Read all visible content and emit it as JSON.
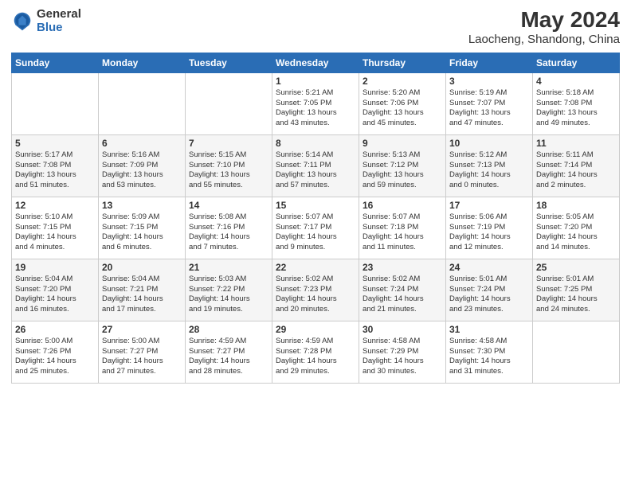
{
  "header": {
    "logo": {
      "general": "General",
      "blue": "Blue"
    },
    "title": "May 2024",
    "location": "Laocheng, Shandong, China"
  },
  "calendar": {
    "days_of_week": [
      "Sunday",
      "Monday",
      "Tuesday",
      "Wednesday",
      "Thursday",
      "Friday",
      "Saturday"
    ],
    "weeks": [
      [
        {
          "day": "",
          "info": ""
        },
        {
          "day": "",
          "info": ""
        },
        {
          "day": "",
          "info": ""
        },
        {
          "day": "1",
          "info": "Sunrise: 5:21 AM\nSunset: 7:05 PM\nDaylight: 13 hours\nand 43 minutes."
        },
        {
          "day": "2",
          "info": "Sunrise: 5:20 AM\nSunset: 7:06 PM\nDaylight: 13 hours\nand 45 minutes."
        },
        {
          "day": "3",
          "info": "Sunrise: 5:19 AM\nSunset: 7:07 PM\nDaylight: 13 hours\nand 47 minutes."
        },
        {
          "day": "4",
          "info": "Sunrise: 5:18 AM\nSunset: 7:08 PM\nDaylight: 13 hours\nand 49 minutes."
        }
      ],
      [
        {
          "day": "5",
          "info": "Sunrise: 5:17 AM\nSunset: 7:08 PM\nDaylight: 13 hours\nand 51 minutes."
        },
        {
          "day": "6",
          "info": "Sunrise: 5:16 AM\nSunset: 7:09 PM\nDaylight: 13 hours\nand 53 minutes."
        },
        {
          "day": "7",
          "info": "Sunrise: 5:15 AM\nSunset: 7:10 PM\nDaylight: 13 hours\nand 55 minutes."
        },
        {
          "day": "8",
          "info": "Sunrise: 5:14 AM\nSunset: 7:11 PM\nDaylight: 13 hours\nand 57 minutes."
        },
        {
          "day": "9",
          "info": "Sunrise: 5:13 AM\nSunset: 7:12 PM\nDaylight: 13 hours\nand 59 minutes."
        },
        {
          "day": "10",
          "info": "Sunrise: 5:12 AM\nSunset: 7:13 PM\nDaylight: 14 hours\nand 0 minutes."
        },
        {
          "day": "11",
          "info": "Sunrise: 5:11 AM\nSunset: 7:14 PM\nDaylight: 14 hours\nand 2 minutes."
        }
      ],
      [
        {
          "day": "12",
          "info": "Sunrise: 5:10 AM\nSunset: 7:15 PM\nDaylight: 14 hours\nand 4 minutes."
        },
        {
          "day": "13",
          "info": "Sunrise: 5:09 AM\nSunset: 7:15 PM\nDaylight: 14 hours\nand 6 minutes."
        },
        {
          "day": "14",
          "info": "Sunrise: 5:08 AM\nSunset: 7:16 PM\nDaylight: 14 hours\nand 7 minutes."
        },
        {
          "day": "15",
          "info": "Sunrise: 5:07 AM\nSunset: 7:17 PM\nDaylight: 14 hours\nand 9 minutes."
        },
        {
          "day": "16",
          "info": "Sunrise: 5:07 AM\nSunset: 7:18 PM\nDaylight: 14 hours\nand 11 minutes."
        },
        {
          "day": "17",
          "info": "Sunrise: 5:06 AM\nSunset: 7:19 PM\nDaylight: 14 hours\nand 12 minutes."
        },
        {
          "day": "18",
          "info": "Sunrise: 5:05 AM\nSunset: 7:20 PM\nDaylight: 14 hours\nand 14 minutes."
        }
      ],
      [
        {
          "day": "19",
          "info": "Sunrise: 5:04 AM\nSunset: 7:20 PM\nDaylight: 14 hours\nand 16 minutes."
        },
        {
          "day": "20",
          "info": "Sunrise: 5:04 AM\nSunset: 7:21 PM\nDaylight: 14 hours\nand 17 minutes."
        },
        {
          "day": "21",
          "info": "Sunrise: 5:03 AM\nSunset: 7:22 PM\nDaylight: 14 hours\nand 19 minutes."
        },
        {
          "day": "22",
          "info": "Sunrise: 5:02 AM\nSunset: 7:23 PM\nDaylight: 14 hours\nand 20 minutes."
        },
        {
          "day": "23",
          "info": "Sunrise: 5:02 AM\nSunset: 7:24 PM\nDaylight: 14 hours\nand 21 minutes."
        },
        {
          "day": "24",
          "info": "Sunrise: 5:01 AM\nSunset: 7:24 PM\nDaylight: 14 hours\nand 23 minutes."
        },
        {
          "day": "25",
          "info": "Sunrise: 5:01 AM\nSunset: 7:25 PM\nDaylight: 14 hours\nand 24 minutes."
        }
      ],
      [
        {
          "day": "26",
          "info": "Sunrise: 5:00 AM\nSunset: 7:26 PM\nDaylight: 14 hours\nand 25 minutes."
        },
        {
          "day": "27",
          "info": "Sunrise: 5:00 AM\nSunset: 7:27 PM\nDaylight: 14 hours\nand 27 minutes."
        },
        {
          "day": "28",
          "info": "Sunrise: 4:59 AM\nSunset: 7:27 PM\nDaylight: 14 hours\nand 28 minutes."
        },
        {
          "day": "29",
          "info": "Sunrise: 4:59 AM\nSunset: 7:28 PM\nDaylight: 14 hours\nand 29 minutes."
        },
        {
          "day": "30",
          "info": "Sunrise: 4:58 AM\nSunset: 7:29 PM\nDaylight: 14 hours\nand 30 minutes."
        },
        {
          "day": "31",
          "info": "Sunrise: 4:58 AM\nSunset: 7:30 PM\nDaylight: 14 hours\nand 31 minutes."
        },
        {
          "day": "",
          "info": ""
        }
      ]
    ]
  }
}
